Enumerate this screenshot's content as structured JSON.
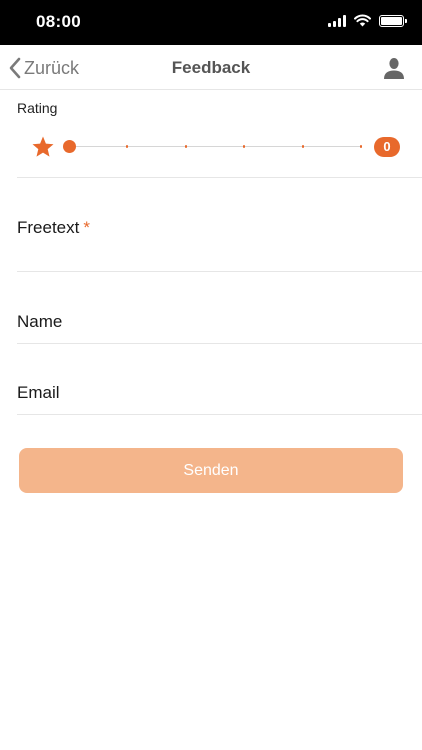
{
  "status_bar": {
    "time": "08:00",
    "icons": [
      "signal-icon",
      "wifi-icon",
      "battery-icon"
    ]
  },
  "nav": {
    "back_label": "Zurück",
    "title": "Feedback",
    "profile_icon": "person-icon"
  },
  "rating": {
    "label": "Rating",
    "value": 0,
    "min": 0,
    "max": 5,
    "badge": "0",
    "icon": "star-icon"
  },
  "form": {
    "freetext": {
      "label": "Freetext",
      "required_mark": "*",
      "value": "",
      "placeholder": ""
    },
    "name": {
      "label": "Name",
      "value": "",
      "placeholder": ""
    },
    "email": {
      "label": "Email",
      "value": "",
      "placeholder": ""
    },
    "submit_label": "Senden"
  },
  "colors": {
    "accent": "#e8692c",
    "button_disabled": "#f4b58b",
    "nav_text": "#555555",
    "divider": "#e6e6e6"
  }
}
